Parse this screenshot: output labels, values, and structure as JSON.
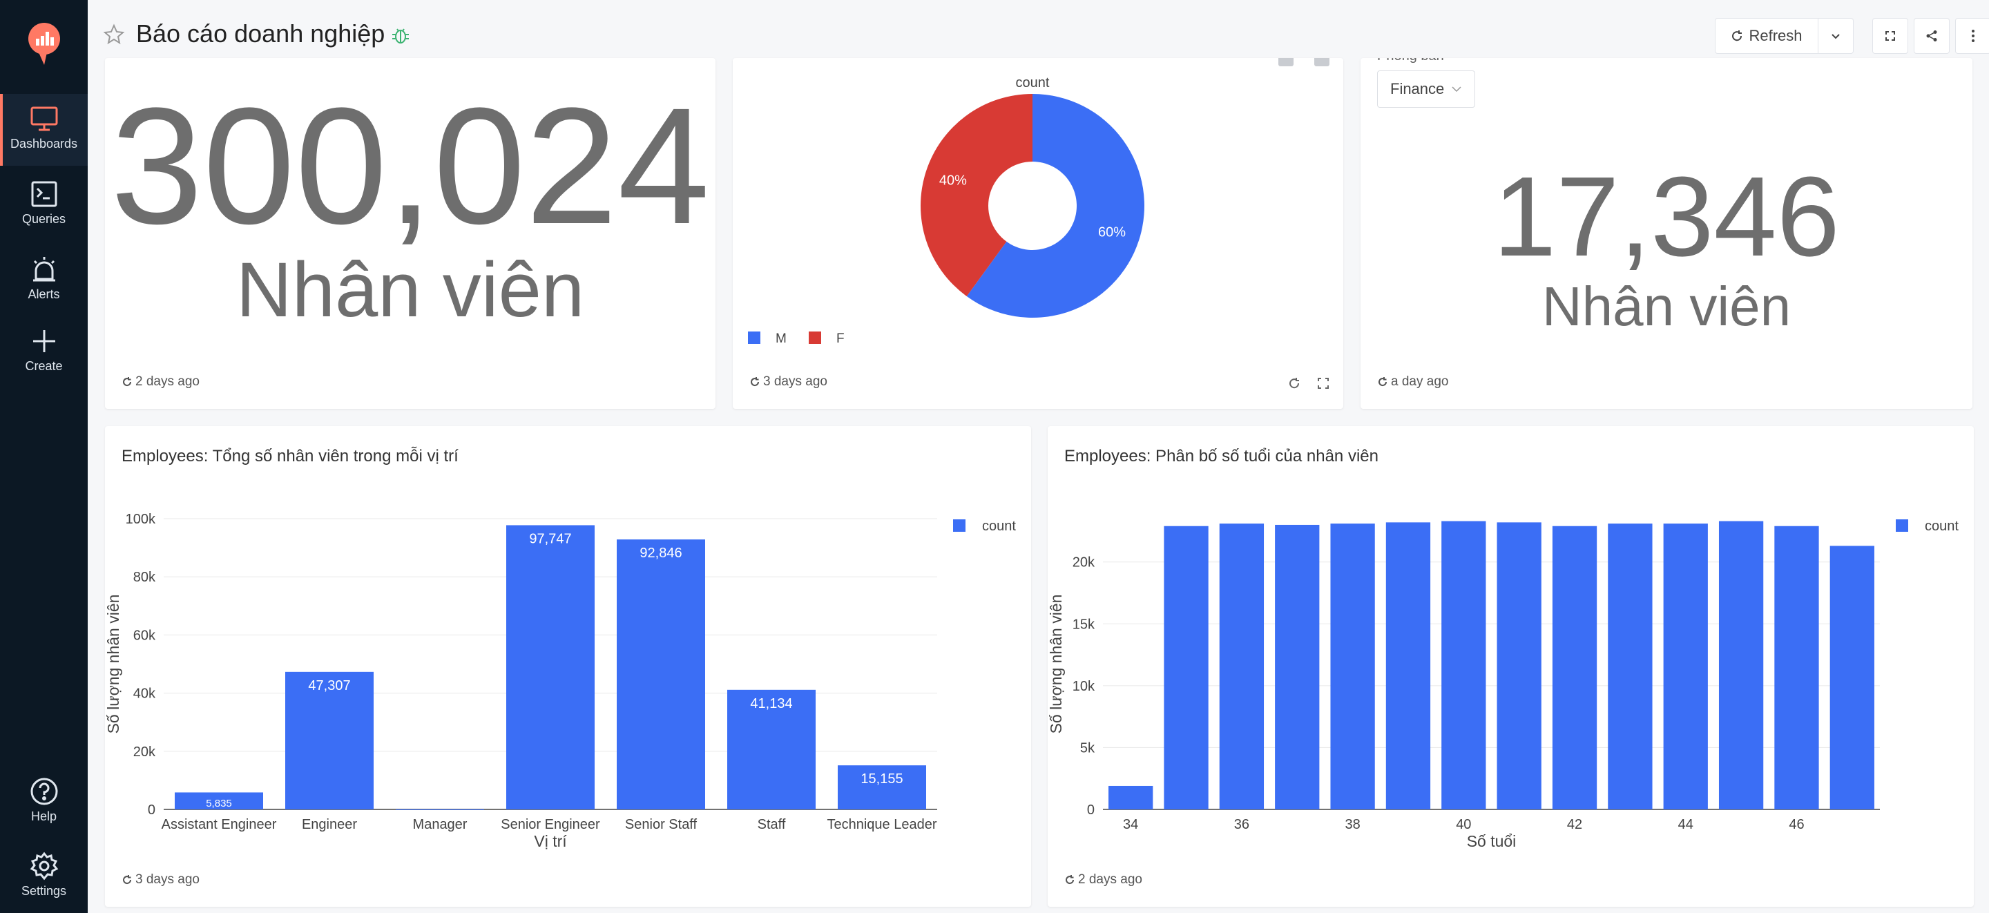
{
  "sidebar": {
    "items": [
      {
        "label": "Dashboards",
        "icon": "monitor-icon"
      },
      {
        "label": "Queries",
        "icon": "terminal-icon"
      },
      {
        "label": "Alerts",
        "icon": "alarm-icon"
      },
      {
        "label": "Create",
        "icon": "plus-icon"
      },
      {
        "label": "Help",
        "icon": "help-icon"
      },
      {
        "label": "Settings",
        "icon": "gear-icon"
      }
    ]
  },
  "header": {
    "title": "Báo cáo doanh nghiệp",
    "refresh_label": "Refresh"
  },
  "colors": {
    "accent": "#3b6ef5",
    "red": "#d83a34",
    "sidebar": "#0c1824"
  },
  "widgets": {
    "employees_total": {
      "value": "300,024",
      "suffix": "Nhân viên",
      "updated": "2 days ago"
    },
    "gender_pie": {
      "updated": "3 days ago"
    },
    "department_count": {
      "param_label": "Phòng ban",
      "param_value": "Finance",
      "value": "17,346",
      "suffix": "Nhân viên",
      "updated": "a day ago"
    },
    "positions": {
      "title": "Employees: Tổng số nhân viên trong mỗi vị trí",
      "updated": "3 days ago"
    },
    "ages": {
      "title": "Employees: Phân bố số tuổi của nhân viên",
      "updated": "2 days ago"
    }
  },
  "chart_data": [
    {
      "type": "pie",
      "title": "count",
      "categories": [
        "M",
        "F"
      ],
      "values": [
        60,
        40
      ],
      "labels": [
        "60%",
        "40%"
      ],
      "colors": [
        "#3b6ef5",
        "#d83a34"
      ],
      "legend": "bottom-left"
    },
    {
      "type": "bar",
      "categories": [
        "Assistant Engineer",
        "Engineer",
        "Manager",
        "Senior Engineer",
        "Senior Staff",
        "Staff",
        "Technique Leader"
      ],
      "series": [
        {
          "name": "count",
          "values": [
            5835,
            47307,
            24,
            97747,
            92846,
            41134,
            15155
          ]
        }
      ],
      "data_labels": [
        "5,835",
        "47,307",
        "",
        "97,747",
        "92,846",
        "41,134",
        "15,155"
      ],
      "xlabel": "Vị trí",
      "ylabel": "Số lượng nhân viên",
      "ylim": [
        0,
        100000
      ],
      "yticks": [
        0,
        20000,
        40000,
        60000,
        80000,
        100000
      ],
      "ytick_labels": [
        "0",
        "20k",
        "40k",
        "60k",
        "80k",
        "100k"
      ],
      "grid": true,
      "legend": "top-right"
    },
    {
      "type": "bar",
      "x": [
        34,
        35,
        36,
        37,
        38,
        39,
        40,
        41,
        42,
        43,
        44,
        45,
        46,
        47
      ],
      "series": [
        {
          "name": "count",
          "values": [
            1900,
            22900,
            23100,
            23000,
            23100,
            23200,
            23300,
            23200,
            22900,
            23100,
            23100,
            23300,
            22900,
            21300
          ]
        }
      ],
      "xticks": [
        34,
        36,
        38,
        40,
        42,
        44,
        46
      ],
      "xlabel": "Số tuổi",
      "ylabel": "Số lượng nhân viên",
      "ylim": [
        0,
        23500
      ],
      "yticks": [
        0,
        5000,
        10000,
        15000,
        20000
      ],
      "ytick_labels": [
        "0",
        "5k",
        "10k",
        "15k",
        "20k"
      ],
      "grid": true,
      "legend": "top-right"
    }
  ]
}
